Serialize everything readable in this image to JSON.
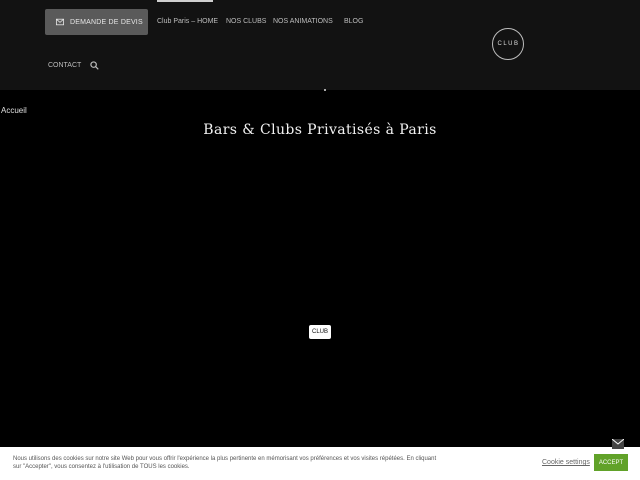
{
  "header": {
    "cta_label": "Demande de devis",
    "nav": [
      "Club Paris – HOME",
      "NOS CLUBS",
      "NOS ANIMATIONS",
      "BLOG"
    ],
    "contact_label": "CONTACT",
    "logo_text": "CLUB"
  },
  "main": {
    "breadcrumb": "Accueil",
    "title": "Bars & Clubs Privatisés à Paris",
    "loader_text": "CLUB"
  },
  "cookie": {
    "text": "Nous utilisons des cookies sur notre site Web pour vous offrir l'expérience la plus pertinente en mémorisant vos préférences et vos visites répétées. En cliquant sur \"Accepter\", vous consentez à l'utilisation de TOUS les cookies.",
    "settings_label": "Cookie settings",
    "accept_label": "ACCEPT"
  }
}
